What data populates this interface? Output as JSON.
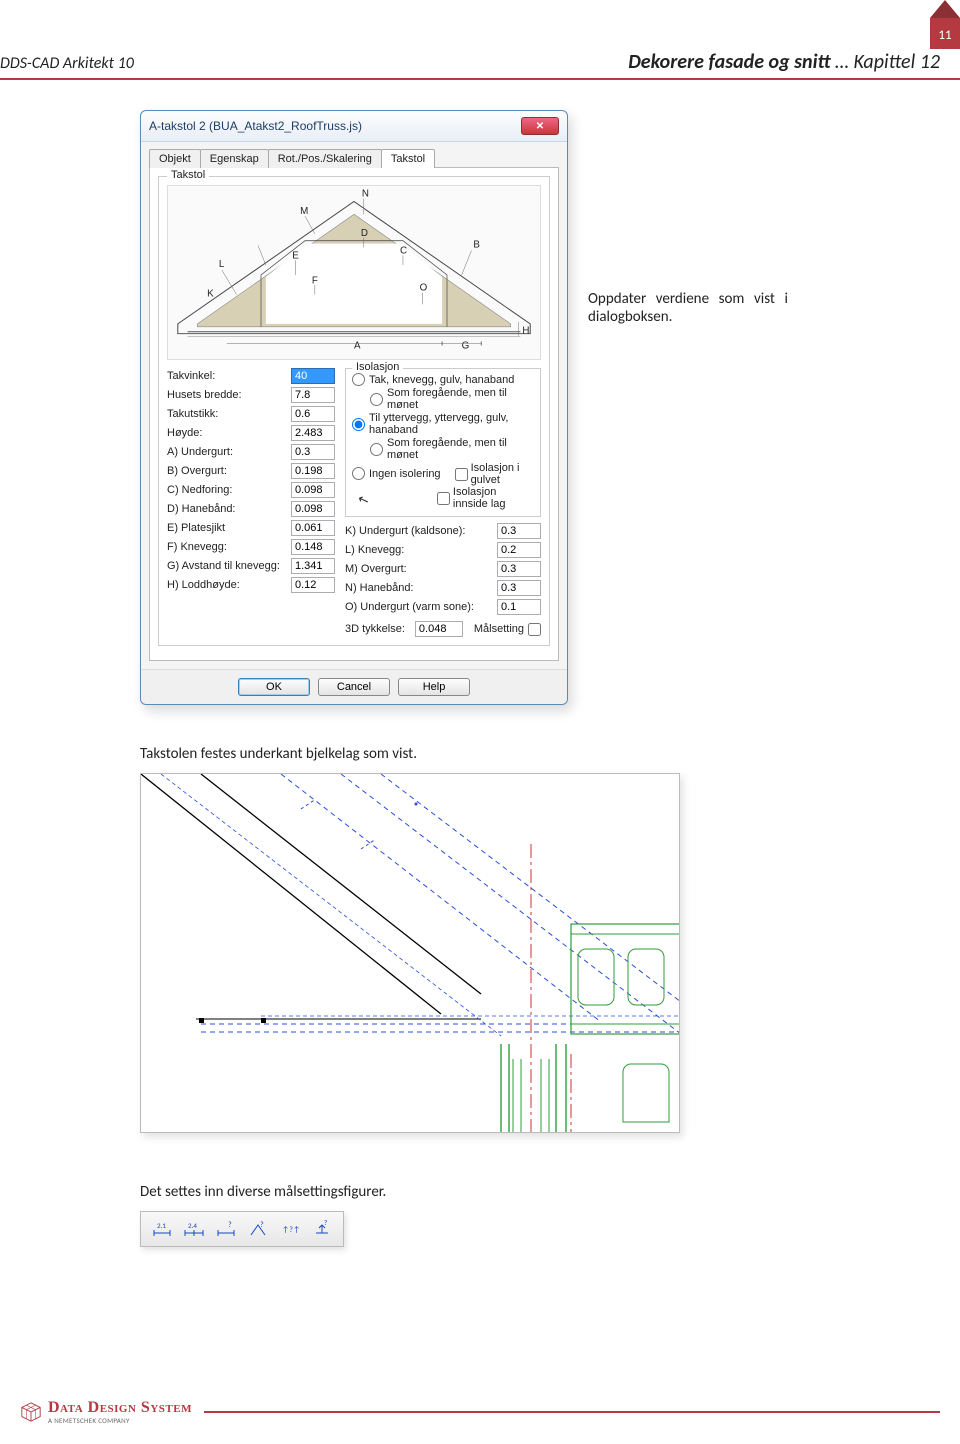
{
  "page_number": "11",
  "header": {
    "left": "DDS-CAD Arkitekt 10",
    "right_bold": "Dekorere fasade og snitt",
    "right_plain": " … Kapittel 12"
  },
  "side_note": "Oppdater verdiene som vist i dialogboksen.",
  "dialog": {
    "title": "A-takstol 2 (BUA_Atakst2_RoofTruss.js)",
    "tabs": [
      "Objekt",
      "Egenskap",
      "Rot./Pos./Skalering",
      "Takstol"
    ],
    "active_tab": "Takstol",
    "group_title": "Takstol",
    "diagram_labels": [
      "K",
      "L",
      "M",
      "N",
      "E",
      "F",
      "D",
      "C",
      "O",
      "B",
      "A",
      "G",
      "H"
    ],
    "left_fields": [
      {
        "label": "Takvinkel:",
        "value": "40",
        "selected": true
      },
      {
        "label": "Husets bredde:",
        "value": "7.8"
      },
      {
        "label": "Takutstikk:",
        "value": "0.6"
      },
      {
        "label": "Høyde:",
        "value": "2.483"
      },
      {
        "label": "A) Undergurt:",
        "value": "0.3"
      },
      {
        "label": "B) Overgurt:",
        "value": "0.198"
      },
      {
        "label": "C) Nedforing:",
        "value": "0.098"
      },
      {
        "label": "D) Hanebånd:",
        "value": "0.098"
      },
      {
        "label": "E) Platesjikt",
        "value": "0.061"
      },
      {
        "label": "F) Knevegg:",
        "value": "0.148"
      },
      {
        "label": "G) Avstand til knevegg:",
        "value": "1.341"
      },
      {
        "label": "H) Loddhøyde:",
        "value": "0.12"
      }
    ],
    "iso_title": "Isolasjon",
    "iso_options": [
      {
        "type": "radio",
        "label": "Tak, knevegg, gulv, hanaband",
        "checked": false
      },
      {
        "type": "radio-indent",
        "label": "Som foregående, men til mønet",
        "checked": false
      },
      {
        "type": "radio",
        "label": "Til yttervegg, yttervegg, gulv, hanaband",
        "checked": true
      },
      {
        "type": "radio-indent",
        "label": "Som foregående, men til mønet",
        "checked": false
      },
      {
        "type": "radio",
        "label": "Ingen isolering",
        "checked": false
      }
    ],
    "iso_checks": [
      {
        "label": "Isolasjon i gulvet",
        "checked": false
      },
      {
        "label": "Isolasjon innside lag",
        "checked": false
      }
    ],
    "right_fields": [
      {
        "label": "K) Undergurt (kaldsone):",
        "value": "0.3"
      },
      {
        "label": "L) Knevegg:",
        "value": "0.2"
      },
      {
        "label": "M) Overgurt:",
        "value": "0.3"
      },
      {
        "label": "N) Hanebånd:",
        "value": "0.3"
      },
      {
        "label": "O) Undergurt (varm sone):",
        "value": "0.1"
      }
    ],
    "bottom": {
      "label": "3D tykkelse:",
      "value": "0.048",
      "check_label": "Målsetting"
    },
    "buttons": {
      "ok": "OK",
      "cancel": "Cancel",
      "help": "Help"
    }
  },
  "caption1": "Takstolen festes underkant bjelkelag som vist.",
  "caption2": "Det settes inn diverse målsettingsfigurer.",
  "toolbar_icons": [
    "dim-horizontal",
    "dim-chain",
    "dim-linear",
    "dim-angle",
    "dim-text",
    "dim-elevation"
  ],
  "footer": {
    "brand": "Data Design System",
    "sub": "A NEMETSCHEK COMPANY"
  }
}
